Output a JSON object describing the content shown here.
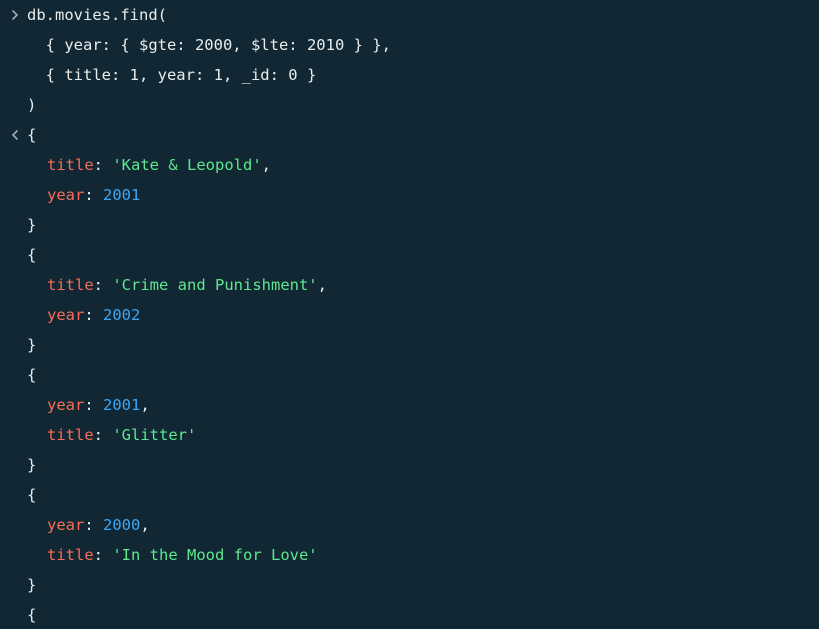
{
  "colors": {
    "background": "#112733",
    "text": "#e8edeb",
    "key": "#f86c57",
    "string": "#5ee88f",
    "number": "#3ba6f5",
    "prompt_icon": "#a0abb1"
  },
  "icons": {
    "input_prompt": "chevron-right-icon",
    "output_marker": "chevron-left-icon"
  },
  "command": {
    "line1": "db.movies.find(",
    "line2": "  { year: { $gte: 2000, $lte: 2010 } },",
    "line3": "  { title: 1, year: 1, _id: 0 }",
    "line4": ")"
  },
  "result": {
    "open_brace": "{",
    "close_brace": "}",
    "colon": ": ",
    "comma": ",",
    "documents": [
      {
        "field1_key": "title",
        "field1_value": "'Kate & Leopold'",
        "field2_key": "year",
        "field2_value": "2001"
      },
      {
        "field1_key": "title",
        "field1_value": "'Crime and Punishment'",
        "field2_key": "year",
        "field2_value": "2002"
      },
      {
        "field1_key": "year",
        "field1_value": "2001",
        "field2_key": "title",
        "field2_value": "'Glitter'"
      },
      {
        "field1_key": "year",
        "field1_value": "2000",
        "field2_key": "title",
        "field2_value": "'In the Mood for Love'"
      }
    ]
  }
}
